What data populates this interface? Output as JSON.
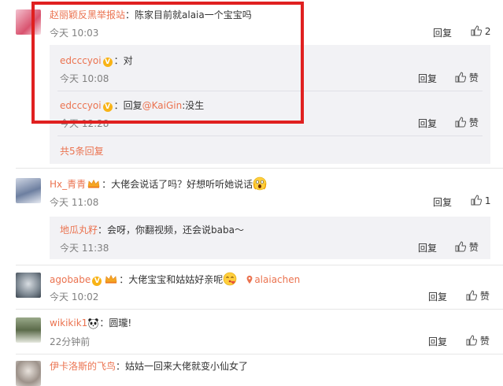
{
  "comments": [
    {
      "user": "赵丽颖反黑举报站",
      "text": "：陈家目前就alaia一个宝宝吗",
      "time": "今天 10:03",
      "reply_label": "回复",
      "like_count": "2",
      "replies": [
        {
          "user": "edcccyoi",
          "text": "：对",
          "time": "今天 10:08",
          "reply_label": "回复",
          "like_label": "赞"
        },
        {
          "user": "edcccyoi",
          "text_prefix": "：回复",
          "mention": "@KaiGin",
          "text_suffix": ":没生",
          "time": "今天 12:28",
          "reply_label": "回复",
          "like_label": "赞"
        }
      ],
      "more_replies": "共5条回复"
    },
    {
      "user": "Hx_青青",
      "text": "：大佬会说话了吗？好想听听她说话",
      "time": "今天 11:08",
      "reply_label": "回复",
      "like_count": "1",
      "replies": [
        {
          "user": "地瓜丸籽",
          "text": "：会呀，你翻视频，还会说baba～",
          "time": "今天 11:38",
          "reply_label": "回复",
          "like_label": "赞"
        }
      ]
    },
    {
      "user": "agobabe",
      "text": "：大佬宝宝和姑姑好亲呢",
      "mention": "alaiachen",
      "time": "今天 10:02",
      "reply_label": "回复",
      "like_label": "赞"
    },
    {
      "user": "wikikik1",
      "text": "：圆瓏!",
      "time": "22分钟前",
      "reply_label": "回复",
      "like_label": "赞"
    },
    {
      "user": "伊卡洛斯的飞鸟",
      "text": "：姑姑一回来大佬就变小仙女了"
    }
  ],
  "colors": {
    "username": "#eb7350",
    "highlight_box": "#e02020",
    "reply_bg": "#f2f2f5"
  }
}
